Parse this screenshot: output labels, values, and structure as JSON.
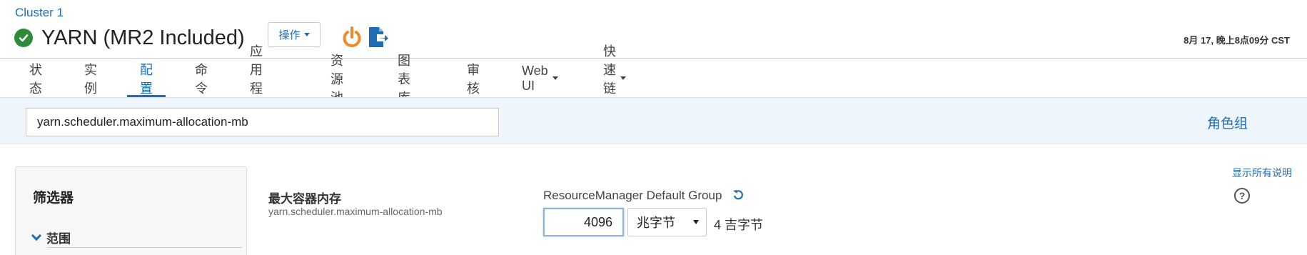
{
  "header": {
    "breadcrumb": "Cluster 1",
    "title": "YARN (MR2 Included)",
    "actions_label": "操作",
    "timestamp": "8月 17, 晚上8点09分 CST",
    "status_icon": "check-circle-icon",
    "status_color": "#2e8b37"
  },
  "tabs": [
    {
      "label": "状态",
      "dropdown": false
    },
    {
      "label": "实例",
      "dropdown": false
    },
    {
      "label": "配置",
      "dropdown": false,
      "active": true
    },
    {
      "label": "命令",
      "dropdown": false
    },
    {
      "label": "应用程序",
      "dropdown": false
    },
    {
      "label": "资源池",
      "dropdown": false
    },
    {
      "label": "图表库",
      "dropdown": false
    },
    {
      "label": "审核",
      "dropdown": false
    },
    {
      "label": "Web UI",
      "dropdown": true
    },
    {
      "label": "快速链接",
      "dropdown": true
    }
  ],
  "search": {
    "value": "yarn.scheduler.maximum-allocation-mb"
  },
  "role_group_link": "角色组",
  "filter": {
    "title": "筛选器",
    "section": "范围"
  },
  "property": {
    "display_name": "最大容器内存",
    "key": "yarn.scheduler.maximum-allocation-mb",
    "group": "ResourceManager Default Group",
    "value": "4096",
    "unit": "兆字节",
    "converted": "4 吉字节"
  },
  "show_all_descriptions": "显示所有说明",
  "colors": {
    "accent": "#1f6db5",
    "power_icon": "#f08a24",
    "search_band": "#eef5fb"
  }
}
